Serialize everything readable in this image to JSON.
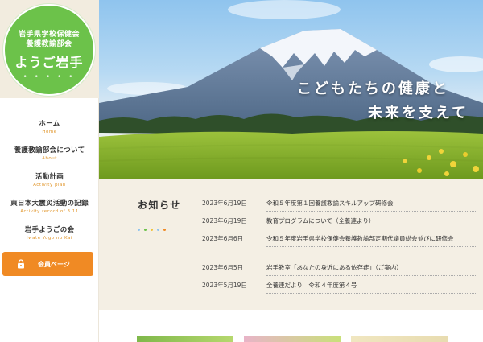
{
  "logo": {
    "line1": "岩手県学校保健会",
    "line2": "養護教諭部会",
    "main": "ようご岩手",
    "dots": "• • • • •"
  },
  "nav": {
    "items": [
      {
        "label": "ホーム",
        "sub": "Home"
      },
      {
        "label": "養護教諭部会について",
        "sub": "About"
      },
      {
        "label": "活動計画",
        "sub": "Activity plan"
      },
      {
        "label": "東日本大震災活動の記録",
        "sub": "Activity record of 3.11"
      },
      {
        "label": "岩手ようごの会",
        "sub": "Iwate Yogo no Kai"
      }
    ],
    "member_button": "会員ページ"
  },
  "hero": {
    "line1": "こどもたちの健康と",
    "line2": "未来を支えて"
  },
  "news": {
    "title": "お知らせ",
    "items": [
      {
        "date": "2023年6月19日",
        "text": "令和５年度第１回養護教諭スキルアップ研修会"
      },
      {
        "date": "2023年6月19日",
        "text": "教育プログラムについて（全養連より）"
      },
      {
        "date": "2023年6月6日",
        "text": "令和５年度岩手県学校保健会養護教諭部定期代議員総会並びに研修会"
      },
      {
        "date": "2023年6月5日",
        "text": "岩手教室「あなたの身近にある依存症」（ご案内）"
      },
      {
        "date": "2023年5月19日",
        "text": "全養連だより　令和４年度第４号"
      }
    ]
  },
  "colors": {
    "brand_green": "#6cc24a",
    "accent_orange": "#f08a24",
    "nav_sub": "#e0952a",
    "dot_colors": [
      "#8fc4ee",
      "#6cc24a",
      "#f0c23a",
      "#8fc4ee",
      "#f08a24"
    ]
  }
}
